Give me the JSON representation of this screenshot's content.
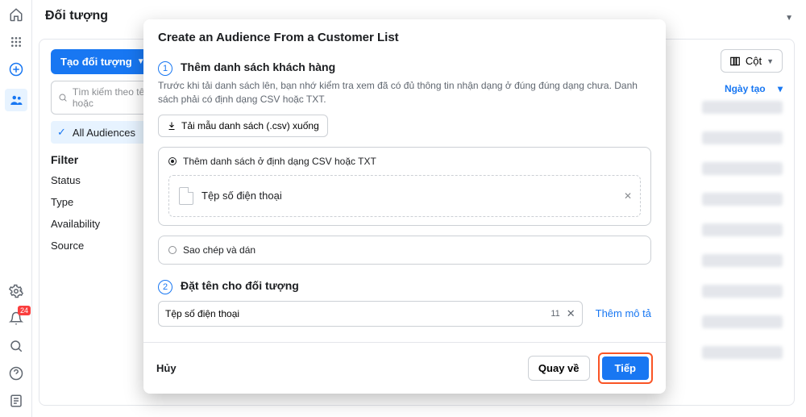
{
  "page": {
    "title": "Đối tượng"
  },
  "leftRail": {
    "notif_badge": "24"
  },
  "sidebar": {
    "create_btn": "Tạo đối tượng",
    "search_placeholder": "Tìm kiếm theo tên hoặc",
    "all_audiences": "All Audiences",
    "filter_title": "Filter",
    "filters": [
      "Status",
      "Type",
      "Availability",
      "Source"
    ]
  },
  "content": {
    "columns_btn": "Cột",
    "date_col": "Ngày tạo"
  },
  "modal": {
    "title": "Create an Audience From a Customer List",
    "step1": {
      "num": "1",
      "title": "Thêm danh sách khách hàng",
      "desc": "Trước khi tải danh sách lên, bạn nhớ kiểm tra xem đã có đủ thông tin nhận dạng ở đúng đúng dạng chưa. Danh sách phải có định dạng CSV hoặc TXT.",
      "download": "Tải mẫu danh sách (.csv) xuống",
      "opt_csv": "Thêm danh sách ở định dạng CSV hoặc TXT",
      "file_label": "Tệp số điện thoại",
      "opt_paste": "Sao chép và dán"
    },
    "step2": {
      "num": "2",
      "title": "Đặt tên cho đối tượng",
      "input_value": "Tệp số điện thoại",
      "char_count": "11",
      "add_desc": "Thêm mô tả"
    },
    "footer": {
      "cancel": "Hủy",
      "back": "Quay về",
      "next": "Tiếp"
    }
  }
}
